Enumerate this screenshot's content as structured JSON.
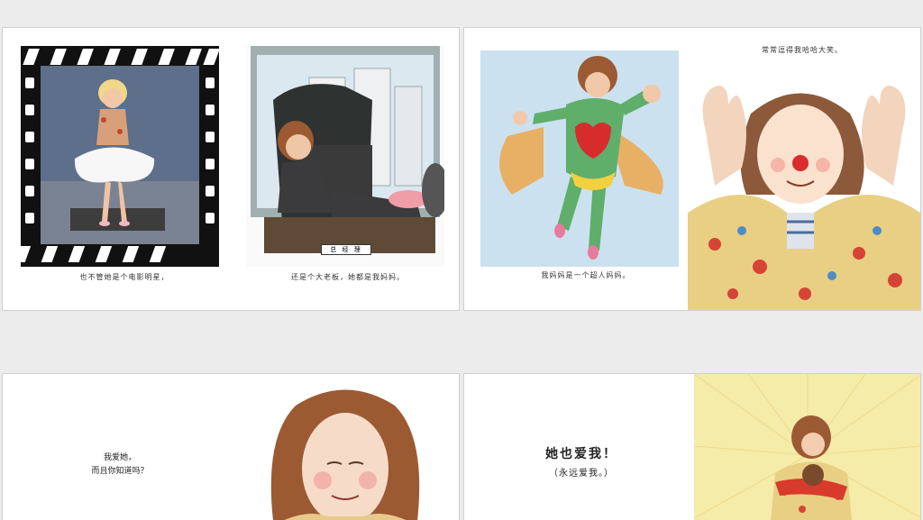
{
  "slides": [
    {
      "left_caption": "也不管她是个电影明星，",
      "right_caption": "还是个大老板，她都是我妈妈。",
      "plaque_text": "总 经 理"
    },
    {
      "left_caption": "我妈妈是一个超人妈妈。",
      "top_caption": "常常逗得我哈哈大笑。"
    },
    {
      "text_line1": "我爱她，",
      "text_line2": "而且你知道吗？"
    },
    {
      "text_line1": "她也爱我！",
      "text_line2": "（永远爱我。）"
    }
  ]
}
